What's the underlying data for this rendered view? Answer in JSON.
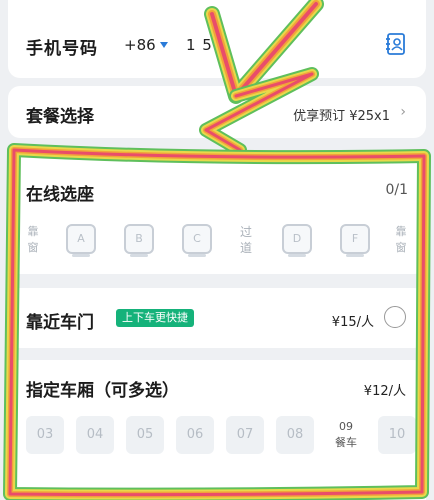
{
  "phone": {
    "label": "手机号码",
    "country_code": "+86",
    "number": "1 51"
  },
  "package": {
    "label": "套餐选择",
    "value": "优享预订 ¥25x1",
    "chevron": "›"
  },
  "seat": {
    "title": "在线选座",
    "count": "0/1",
    "window_left": "靠\n窗",
    "window_right": "靠\n窗",
    "aisle": "过\n道",
    "seats": [
      "A",
      "B",
      "C",
      "D",
      "F"
    ]
  },
  "door": {
    "label": "靠近车门",
    "badge": "上下车更快捷",
    "price": "¥15/人"
  },
  "cars": {
    "label": "指定车厢（可多选）",
    "price": "¥12/人",
    "items": [
      "03",
      "04",
      "05",
      "06",
      "07",
      "08"
    ],
    "dining_number": "09",
    "dining_label": "餐车",
    "last": "10"
  },
  "icons": {
    "contact": "contact-book-icon",
    "dropdown": "triangle-down-icon",
    "chevron": "chevron-right-icon",
    "radio": "radio-circle-icon"
  },
  "colors": {
    "accent_blue": "#2a7bd8",
    "badge_green": "#15b27a",
    "overlay_red": "#e94d6a",
    "overlay_orange": "#f2a33a",
    "overlay_yellow": "#e9d84a",
    "overlay_green": "#5fbf5c"
  }
}
